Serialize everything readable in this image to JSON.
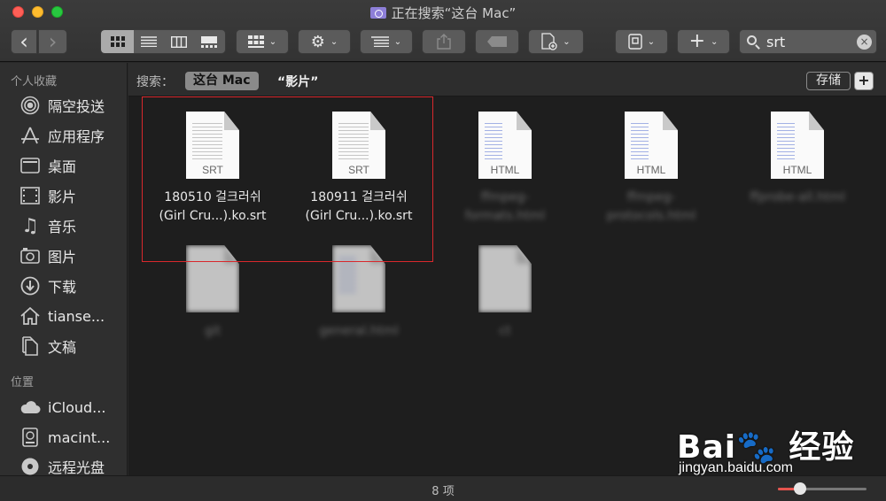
{
  "window": {
    "title": "正在搜索“这台 Mac”"
  },
  "toolbar": {
    "back": "‹",
    "forward": "›",
    "arrange_icon": "arrange-icon",
    "action_icon": "gear-icon",
    "share_icon": "share-icon",
    "tags_icon": "tag-icon",
    "add_label": "+",
    "dropdown": "⌄"
  },
  "search": {
    "query": "srt",
    "clear": "×"
  },
  "sidebar": {
    "favorites_header": "个人收藏",
    "favorites": [
      {
        "label": "隔空投送",
        "icon": "airdrop-icon"
      },
      {
        "label": "应用程序",
        "icon": "applications-icon"
      },
      {
        "label": "桌面",
        "icon": "desktop-icon"
      },
      {
        "label": "影片",
        "icon": "movies-icon"
      },
      {
        "label": "音乐",
        "icon": "music-icon"
      },
      {
        "label": "图片",
        "icon": "pictures-icon"
      },
      {
        "label": "下载",
        "icon": "downloads-icon"
      },
      {
        "label": "tianse...",
        "icon": "home-icon"
      },
      {
        "label": "文稿",
        "icon": "documents-icon"
      }
    ],
    "locations_header": "位置",
    "locations": [
      {
        "label": "iCloud...",
        "icon": "icloud-icon"
      },
      {
        "label": "macint...",
        "icon": "disk-icon"
      },
      {
        "label": "远程光盘",
        "icon": "remote-disc-icon"
      }
    ]
  },
  "scope": {
    "label": "搜索：",
    "this_mac": "这台 Mac",
    "movies": "“影片”",
    "save": "存储",
    "add": "+"
  },
  "files": [
    {
      "line1": "180510 걸크러쉬",
      "line2": "(Girl Cru...).ko.srt",
      "ext": "SRT",
      "blurred": false
    },
    {
      "line1": "180911 걸크러쉬",
      "line2": "(Girl Cru...).ko.srt",
      "ext": "SRT",
      "blurred": false
    },
    {
      "line1": "ffmpeg-",
      "line2": "formats.html",
      "ext": "HTML",
      "blurred": true
    },
    {
      "line1": "ffmpeg-",
      "line2": "protocols.html",
      "ext": "HTML",
      "blurred": true
    },
    {
      "line1": "ffprobe-all.html",
      "line2": "",
      "ext": "HTML",
      "blurred": true
    },
    {
      "line1": "git",
      "line2": "",
      "ext": "",
      "blurred": true
    },
    {
      "line1": "general.html",
      "line2": "",
      "ext": "",
      "blurred": true
    },
    {
      "line1": "ct",
      "line2": "",
      "ext": "",
      "blurred": true
    }
  ],
  "status": {
    "count": "8 项",
    "icon_size": 0.25
  },
  "watermark": {
    "brand": "Bai🐾 经验",
    "url": "jingyan.baidu.com"
  },
  "colors": {
    "highlight": "#d9282c",
    "slider_fill": "#e6544e"
  }
}
